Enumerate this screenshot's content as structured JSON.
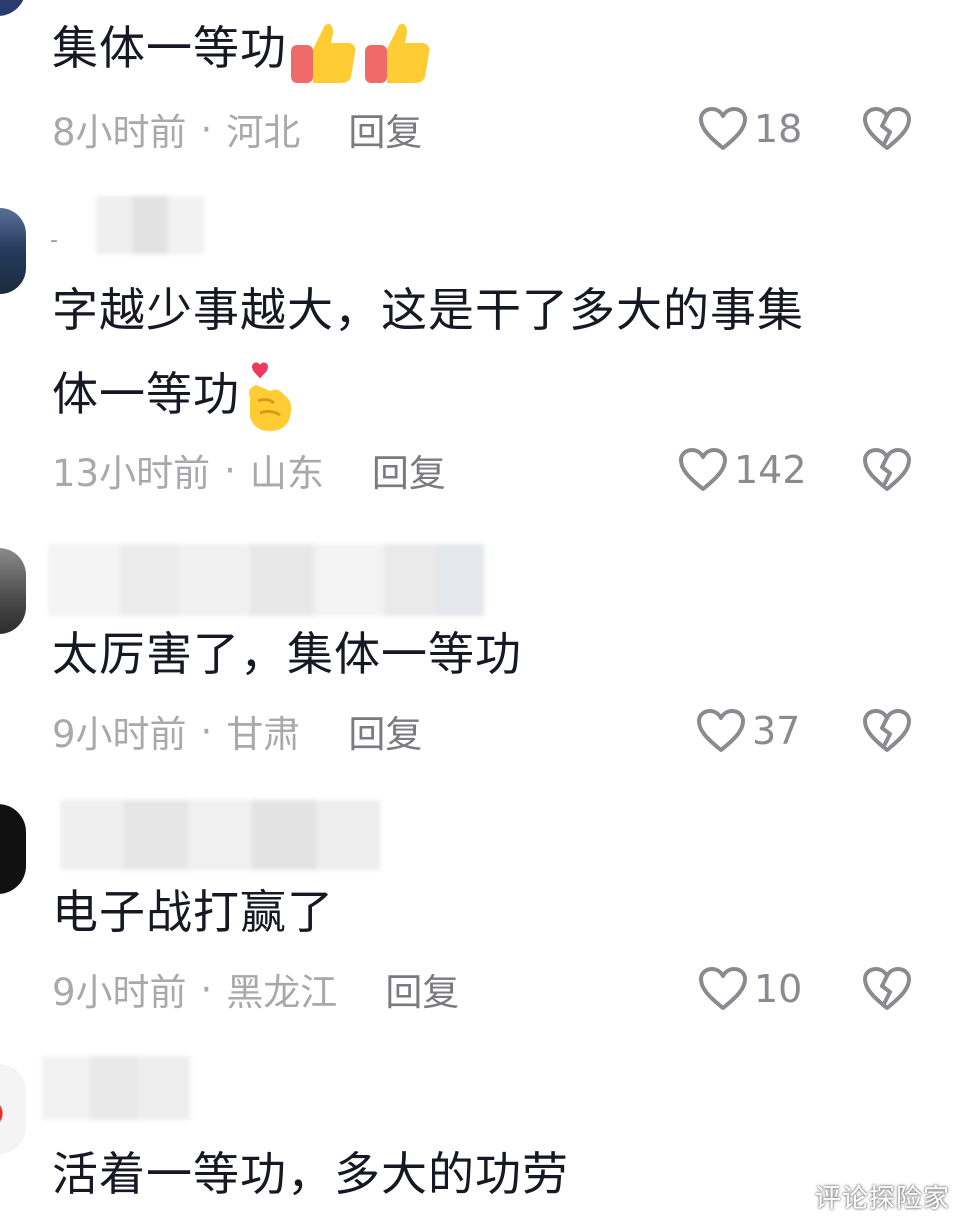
{
  "comments": [
    {
      "username_placeholder": "",
      "text": "集体一等功",
      "time": "8小时前",
      "location": "河北",
      "reply": "回复",
      "likes": "18",
      "emoji": [
        "thumbs-up",
        "thumbs-up"
      ]
    },
    {
      "username_placeholder": "-",
      "text_line1": "字越少事越大，这是干了多大的事集",
      "text_line2": "体一等功",
      "time": "13小时前",
      "location": "山东",
      "reply": "回复",
      "likes": "142",
      "emoji": [
        "finger-heart"
      ]
    },
    {
      "text": "太厉害了，集体一等功",
      "time": "9小时前",
      "location": "甘肃",
      "reply": "回复",
      "likes": "37"
    },
    {
      "text": "电子战打赢了",
      "time": "9小时前",
      "location": "黑龙江",
      "reply": "回复",
      "likes": "10"
    },
    {
      "text": "活着一等功，多大的功劳"
    }
  ],
  "separator": "·",
  "watermark": "评论探险家",
  "icons": {
    "like": "heart-outline-icon",
    "dislike": "broken-heart-icon"
  },
  "colors": {
    "text": "#161823",
    "meta": "#a8a8ad",
    "reply": "#7a7a80",
    "icon": "#8a8a90"
  }
}
